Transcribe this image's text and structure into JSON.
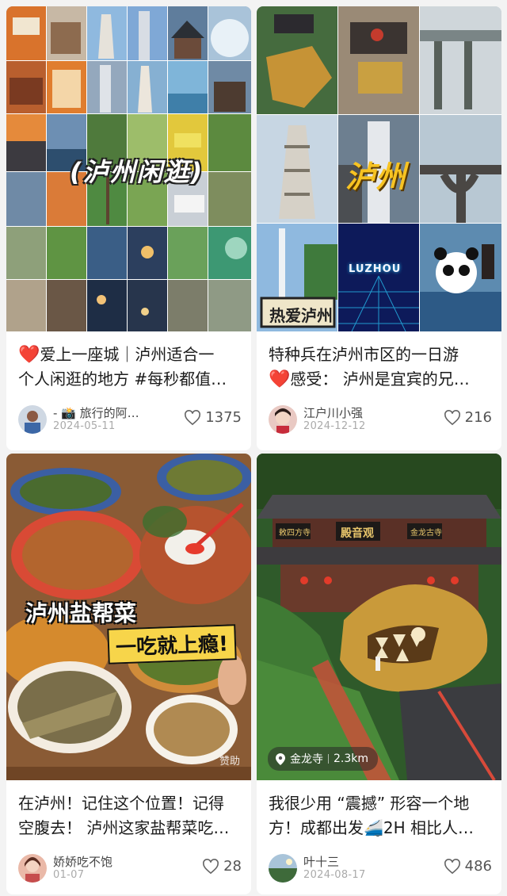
{
  "cards": [
    {
      "title_line1": "爱上一座城｜泸州适合一",
      "title_line2": "个人闲逛的地方 #每秒都值…",
      "cover_text": "泸州闲逛",
      "author": "- 📸 旅行的阿…",
      "date": "2024-05-11",
      "likes": "1375"
    },
    {
      "title_line1": "特种兵在泸州市区的一日游",
      "title_line2": "感受： 泸州是宜宾的兄…",
      "cover_text": "泸州",
      "cover_sign": "热爱泸州",
      "cover_neon": "LUZHOU",
      "author": "江户川小强",
      "date": "2024-12-12",
      "likes": "216"
    },
    {
      "title_line1": "在泸州！记住这个位置！记得",
      "title_line2": "空腹去！ 泸州这家盐帮菜吃…",
      "cover_text1": "泸州盐帮菜",
      "cover_text2": "一吃就上瘾!",
      "cover_corner": "赞助",
      "author": "娇娇吃不饱",
      "date": "01-07",
      "likes": "28"
    },
    {
      "title_line1": "我很少用 “震撼” 形容一个地",
      "title_line2": "方！成都出发🚄2H 相比人…",
      "location_name": "金龙寺",
      "location_distance": "2.3km",
      "cover_plaque_left": "敕四方寺",
      "cover_plaque_center": "殿音观",
      "cover_plaque_right": "金龙古寺",
      "author": "叶十三",
      "date": "2024-08-17",
      "likes": "486"
    }
  ],
  "colors": {
    "background": "#f3f3f3",
    "card": "#ffffff",
    "heart": "#e0212d",
    "meta": "#aaaaaa"
  },
  "icons": {
    "like": "heart-outline-icon",
    "location": "location-pin-icon",
    "emoji": "red-heart-emoji"
  }
}
